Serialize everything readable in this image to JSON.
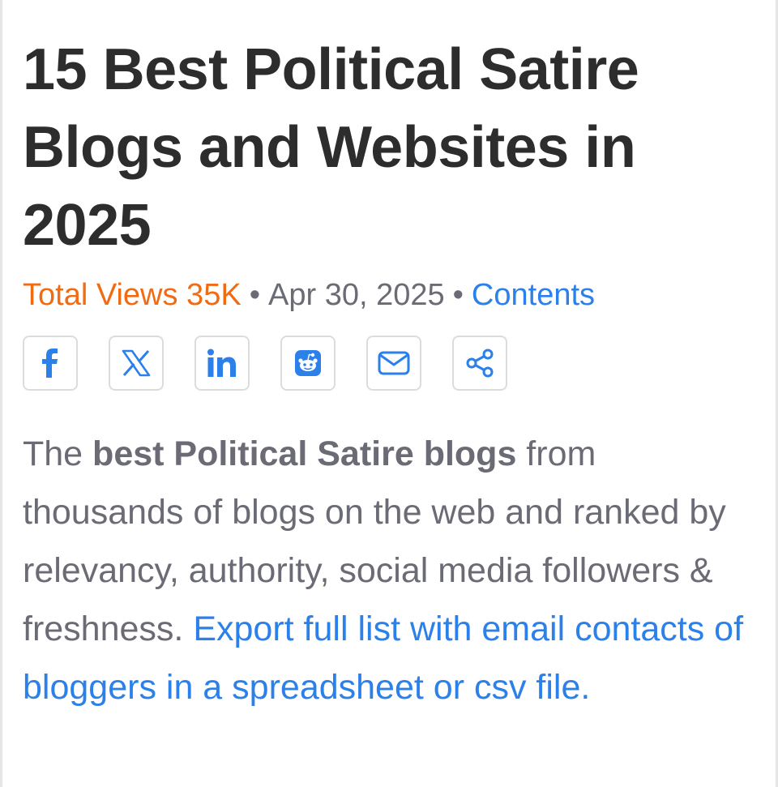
{
  "article": {
    "title": "15 Best Political Satire Blogs and Websites in 2025",
    "meta": {
      "views": "Total Views 35K",
      "separator": "•",
      "date": "Apr 30, 2025",
      "contents_link": "Contents"
    },
    "share_buttons": [
      {
        "icon": "facebook-icon"
      },
      {
        "icon": "x-icon"
      },
      {
        "icon": "linkedin-icon"
      },
      {
        "icon": "reddit-icon"
      },
      {
        "icon": "email-icon"
      },
      {
        "icon": "share-icon"
      }
    ],
    "intro": {
      "lead": "The ",
      "bold": "best Political Satire blogs",
      "rest": " from thousands of blogs on the web and ranked by relevancy, authority, social media followers & freshness. ",
      "export_link": "Export full list with email contacts of bloggers in a spreadsheet or csv file."
    }
  },
  "colors": {
    "title": "#2d2d2d",
    "views": "#f06b12",
    "muted": "#6b6b76",
    "link": "#2b80ea",
    "button_border": "#dcdce0"
  }
}
